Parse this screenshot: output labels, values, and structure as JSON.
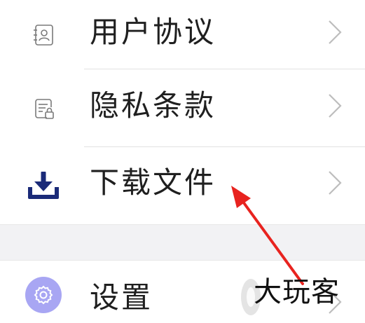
{
  "menu": {
    "items": [
      {
        "label": "用户协议",
        "icon": "user-agreement-icon"
      },
      {
        "label": "隐私条款",
        "icon": "privacy-policy-icon"
      },
      {
        "label": "下载文件",
        "icon": "download-icon"
      }
    ],
    "settings": {
      "label": "设置",
      "icon": "gear-icon"
    }
  },
  "watermark": {
    "text": "大玩客"
  },
  "colors": {
    "download_icon": "#1a2a78",
    "settings_badge": "#a8a6f3",
    "arrow": "#e8231f",
    "chevron": "#bdbdbd",
    "section_gap": "#f2f2f4"
  }
}
